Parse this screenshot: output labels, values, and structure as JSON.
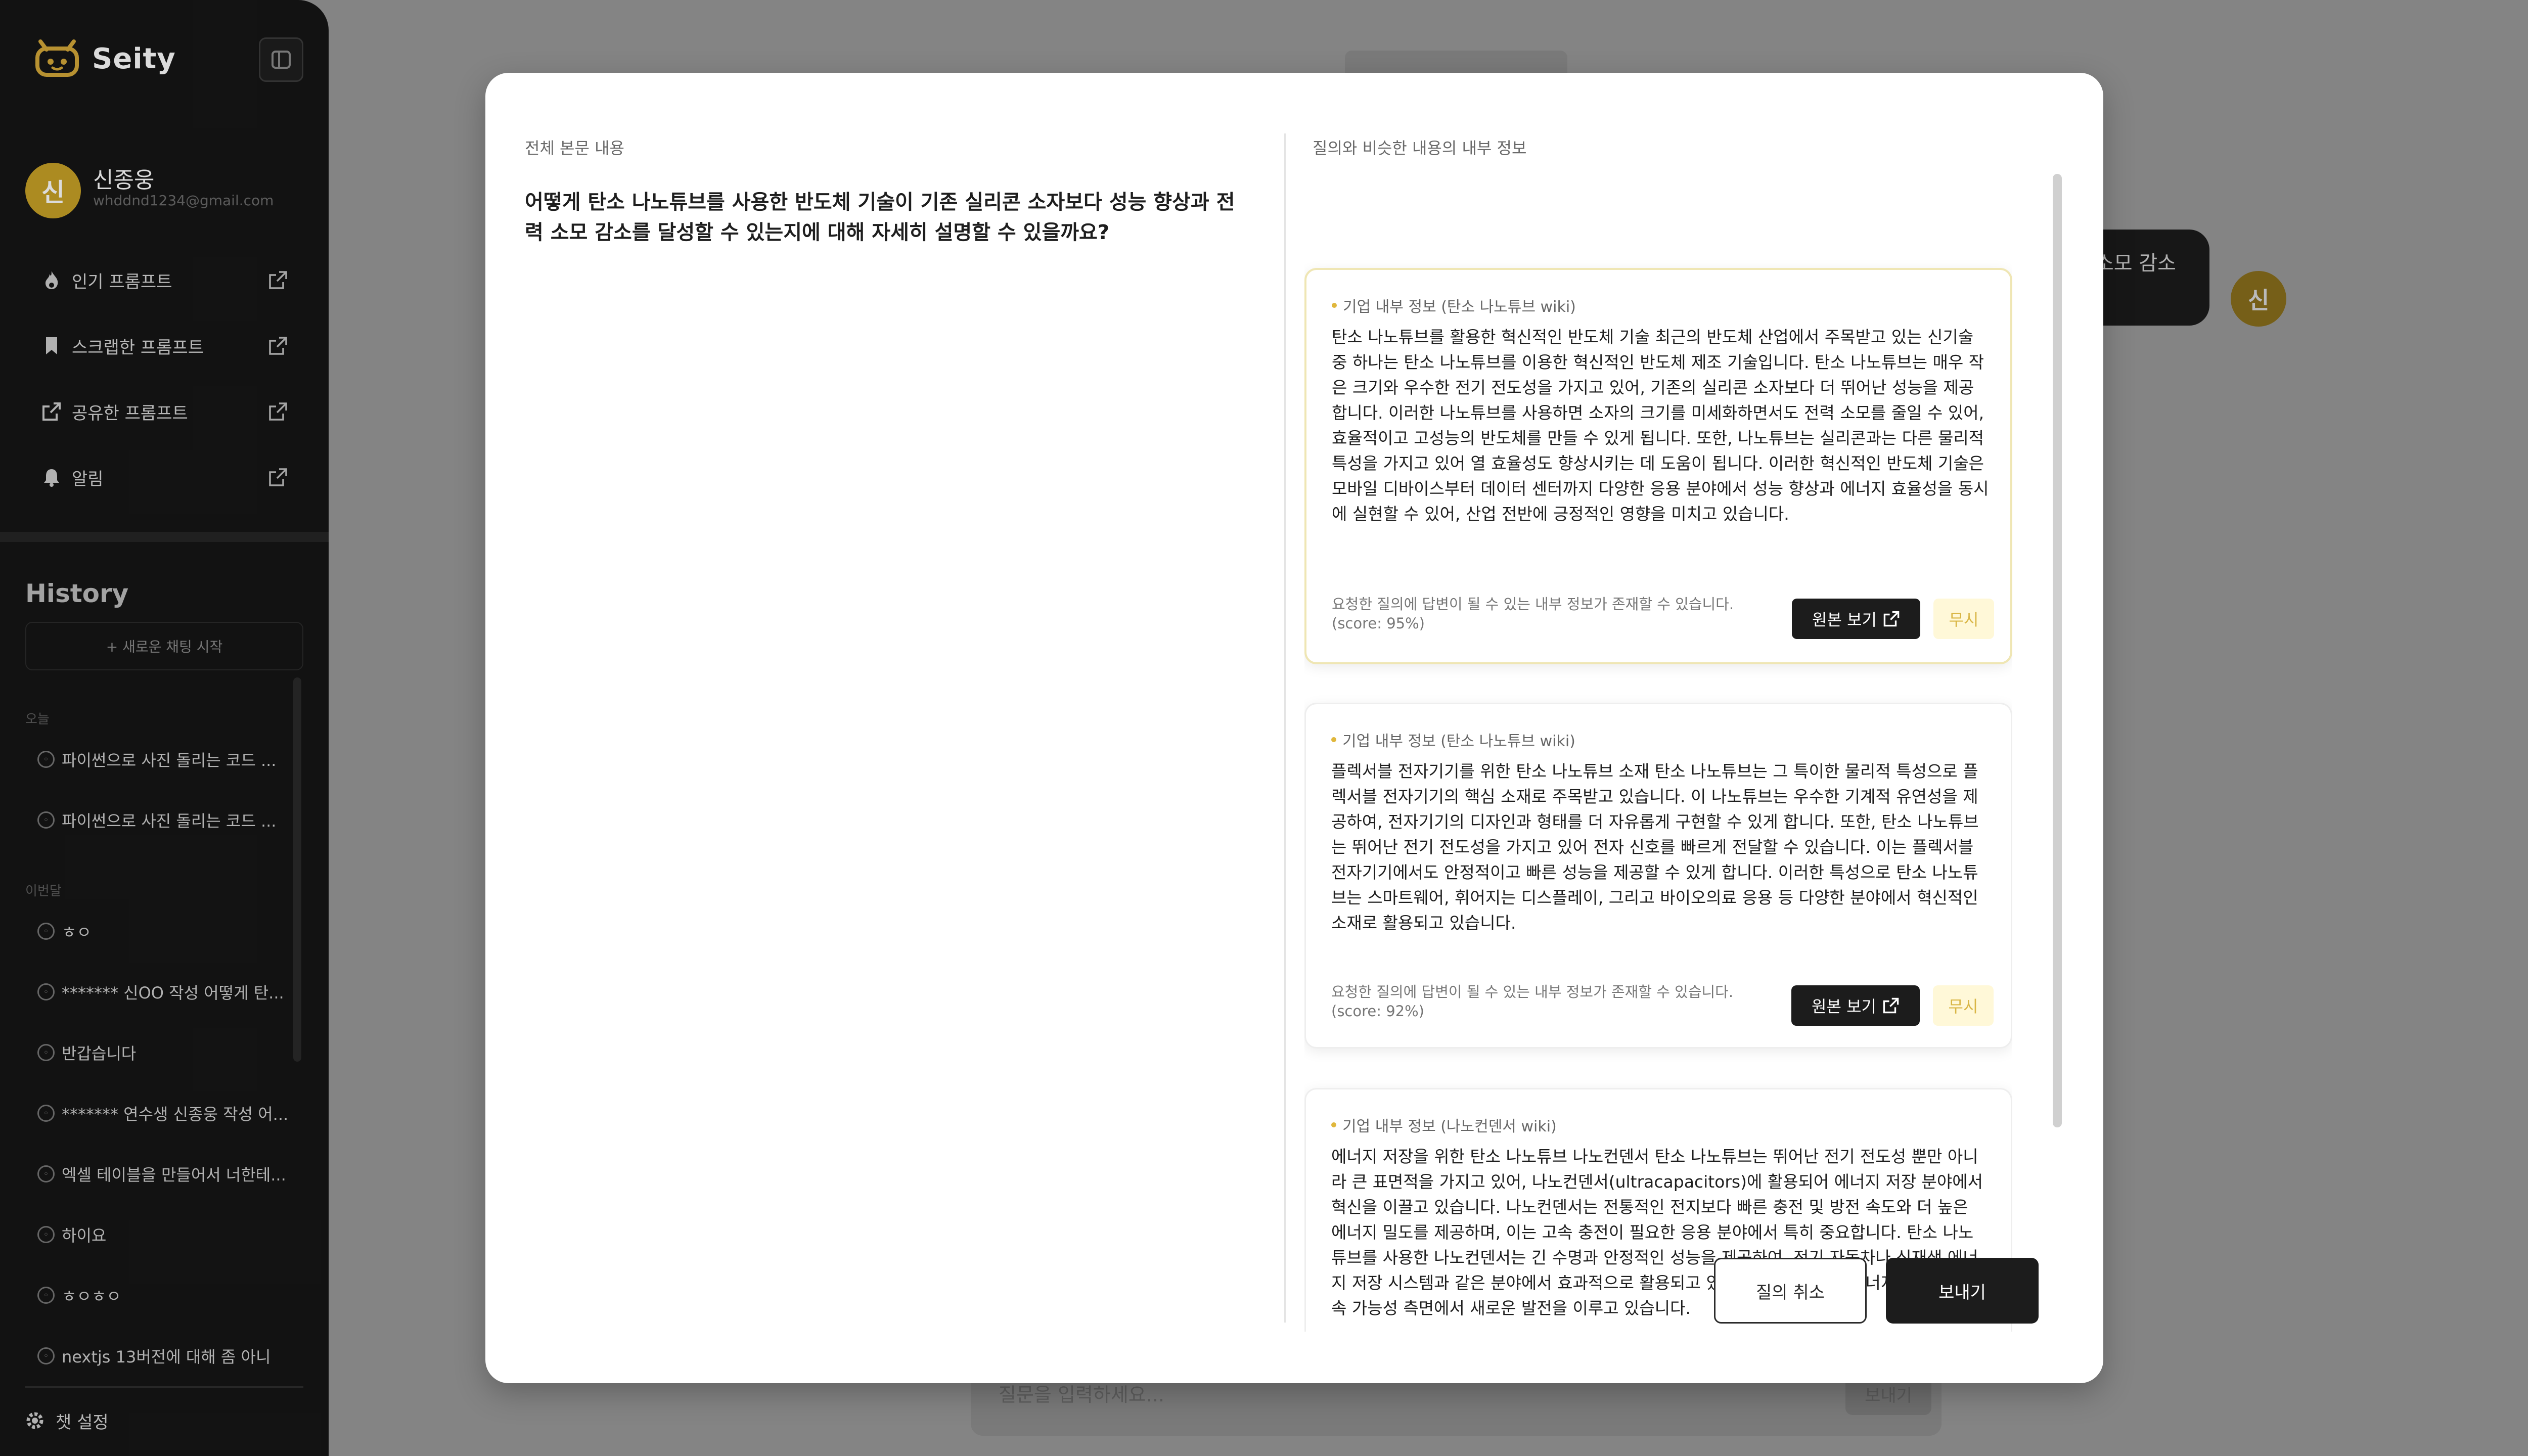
{
  "app": {
    "name": "Seity"
  },
  "user": {
    "avatar_char": "신",
    "name": "신종웅",
    "email": "whddnd1234@gmail.com"
  },
  "nav": [
    {
      "label": "인기 프롬프트",
      "icon": "fire-icon"
    },
    {
      "label": "스크랩한 프롬프트",
      "icon": "bookmark-icon"
    },
    {
      "label": "공유한 프롬프트",
      "icon": "share-icon"
    },
    {
      "label": "알림",
      "icon": "bell-icon"
    }
  ],
  "history": {
    "title": "History",
    "new_chat": "+ 새로운 채팅 시작",
    "sections": [
      {
        "label": "오늘",
        "items": [
          "파이썬으로 사진 돌리는 코드 ...",
          "파이썬으로 사진 돌리는 코드 ..."
        ]
      },
      {
        "label": "이번달",
        "items": [
          "ㅎㅇ",
          "******* 신OO 작성 어떻게 탄...",
          "반갑습니다",
          "******* 연수생 신종웅 작성 어...",
          "엑셀 테이블을 만들어서 너한테...",
          "하이요",
          "ㅎㅇㅎㅇ",
          "nextjs 13버전에 대해 좀 아니"
        ]
      }
    ]
  },
  "settings_label": "챗 설정",
  "background": {
    "bubble_text": "소모 감소",
    "avatar_char": "신",
    "input_placeholder": "질문을 입력하세요...",
    "send_label": "보내기"
  },
  "modal": {
    "left_label": "전체 본문 내용",
    "question": "어떻게 탄소 나노튜브를 사용한 반도체 기술이 기존 실리콘 소자보다 성능 향상과 전력 소모 감소를 달성할 수 있는지에 대해 자세히 설명할 수 있을까요?",
    "right_label": "질의와 비슷한 내용의 내부 정보",
    "cards": [
      {
        "tag": "기업 내부 정보 (탄소 나노튜브 wiki)",
        "body": "탄소 나노튜브를 활용한 혁신적인 반도체 기술 최근의 반도체 산업에서 주목받고 있는 신기술 중 하나는 탄소 나노튜브를 이용한 혁신적인 반도체 제조 기술입니다. 탄소 나노튜브는 매우 작은 크기와 우수한 전기 전도성을 가지고 있어, 기존의 실리콘 소자보다 더 뛰어난 성능을 제공합니다. 이러한 나노튜브를 사용하면 소자의 크기를 미세화하면서도 전력 소모를 줄일 수 있어, 효율적이고 고성능의 반도체를 만들 수 있게 됩니다. 또한, 나노튜브는 실리콘과는 다른 물리적 특성을 가지고 있어 열 효율성도 향상시키는 데 도움이 됩니다. 이러한 혁신적인 반도체 기술은 모바일 디바이스부터 데이터 센터까지 다양한 응용 분야에서 성능 향상과 에너지 효율성을 동시에 실현할 수 있어, 산업 전반에 긍정적인 영향을 미치고 있습니다.",
        "note": "요청한 질의에 답변이 될 수 있는 내부 정보가 존재할 수 있습니다.",
        "score": "(score: 95%)",
        "view_label": "원본 보기",
        "ignore_label": "무시"
      },
      {
        "tag": "기업 내부 정보 (탄소 나노튜브 wiki)",
        "body": "플렉서블 전자기기를 위한 탄소 나노튜브 소재 탄소 나노튜브는 그 특이한 물리적 특성으로 플렉서블 전자기기의 핵심 소재로 주목받고 있습니다. 이 나노튜브는 우수한 기계적 유연성을 제공하여, 전자기기의 디자인과 형태를 더 자유롭게 구현할 수 있게 합니다. 또한, 탄소 나노튜브는 뛰어난 전기 전도성을 가지고 있어 전자 신호를 빠르게 전달할 수 있습니다. 이는 플렉서블 전자기기에서도 안정적이고 빠른 성능을 제공할 수 있게 합니다. 이러한 특성으로 탄소 나노튜브는 스마트웨어, 휘어지는 디스플레이, 그리고 바이오의료 응용 등 다양한 분야에서 혁신적인 소재로 활용되고 있습니다.",
        "note": "요청한 질의에 답변이 될 수 있는 내부 정보가 존재할 수 있습니다.",
        "score": "(score: 92%)",
        "view_label": "원본 보기",
        "ignore_label": "무시"
      },
      {
        "tag": "기업 내부 정보 (나노컨덴서 wiki)",
        "body": "에너지 저장을 위한 탄소 나노튜브 나노컨덴서 탄소 나노튜브는 뛰어난 전기 전도성 뿐만 아니라 큰 표면적을 가지고 있어, 나노컨덴서(ultracapacitors)에 활용되어 에너지 저장 분야에서 혁신을 이끌고 있습니다. 나노컨덴서는 전통적인 전지보다 빠른 충전 및 방전 속도와 더 높은 에너지 밀도를 제공하며, 이는 고속 충전이 필요한 응용 분야에서 특히 중요합니다. 탄소 나노튜브를 사용한 나노컨덴서는 긴 수명과 안정적인 성능을 제공하여, 전기 자동차나 신재생 에너지 저장 시스템과 같은 분야에서 효과적으로 활용되고 있습니다. 이를 통해 에너지 효율성과 지속 가능성 측면에서 새로운 발전을 이루고 있습니다."
      }
    ],
    "cancel_label": "질의 취소",
    "send_label": "보내기"
  }
}
